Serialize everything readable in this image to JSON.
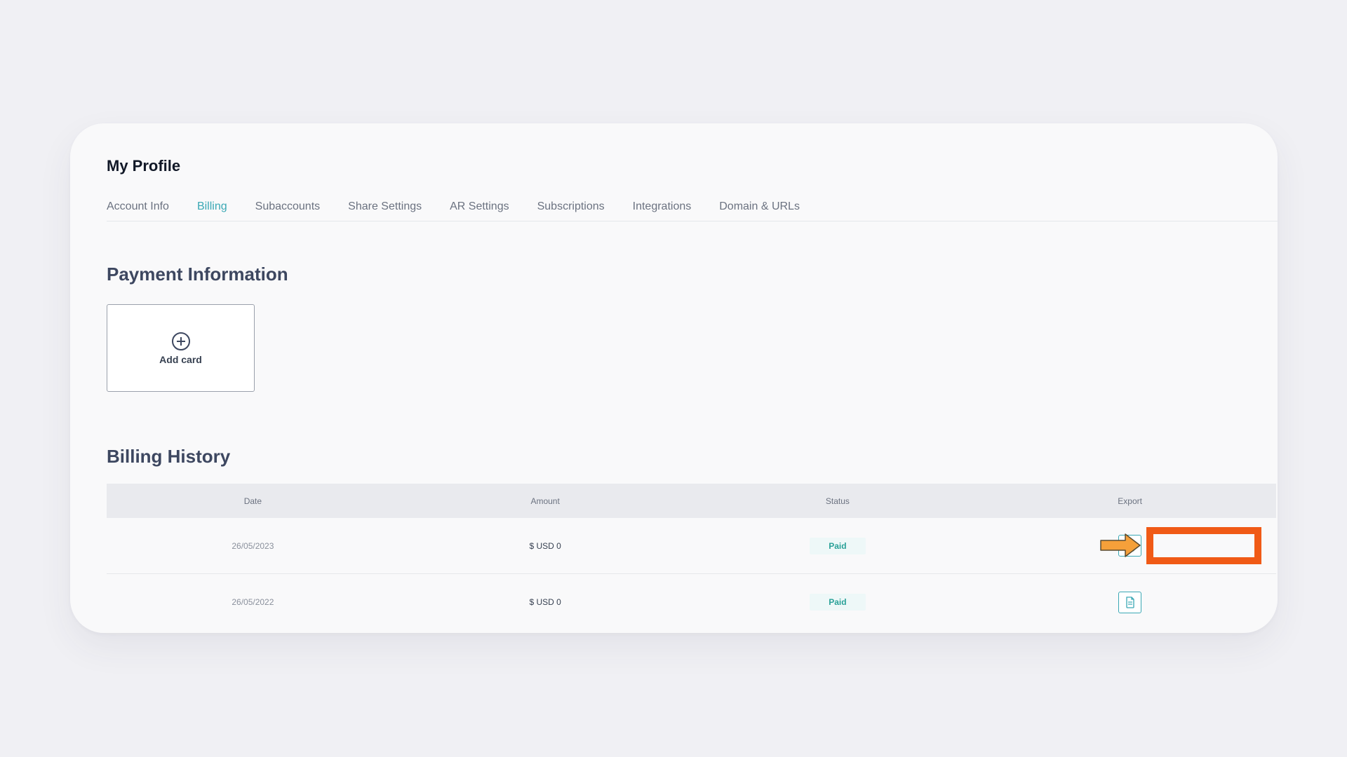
{
  "page": {
    "title": "My Profile"
  },
  "tabs": [
    {
      "label": "Account Info",
      "active": false
    },
    {
      "label": "Billing",
      "active": true
    },
    {
      "label": "Subaccounts",
      "active": false
    },
    {
      "label": "Share Settings",
      "active": false
    },
    {
      "label": "AR Settings",
      "active": false
    },
    {
      "label": "Subscriptions",
      "active": false
    },
    {
      "label": "Integrations",
      "active": false
    },
    {
      "label": "Domain & URLs",
      "active": false
    }
  ],
  "payment": {
    "title": "Payment Information",
    "add_card_label": "Add card",
    "add_card_icon": "plus-circle-icon"
  },
  "billing_history": {
    "title": "Billing History",
    "columns": [
      "Date",
      "Amount",
      "Status",
      "Export"
    ],
    "rows": [
      {
        "date": "26/05/2023",
        "amount": "$ USD 0",
        "status": "Paid",
        "export_icon": "document-export-icon"
      },
      {
        "date": "26/05/2022",
        "amount": "$ USD 0",
        "status": "Paid",
        "export_icon": "document-export-icon"
      }
    ]
  },
  "annotation": {
    "arrow_color": "#f5a03a",
    "highlight_color": "#f05a16",
    "highlight_target": "row-1-export"
  },
  "colors": {
    "accent": "#3aa8b4",
    "status_paid": "#2aa198",
    "heading": "#3d4760"
  }
}
